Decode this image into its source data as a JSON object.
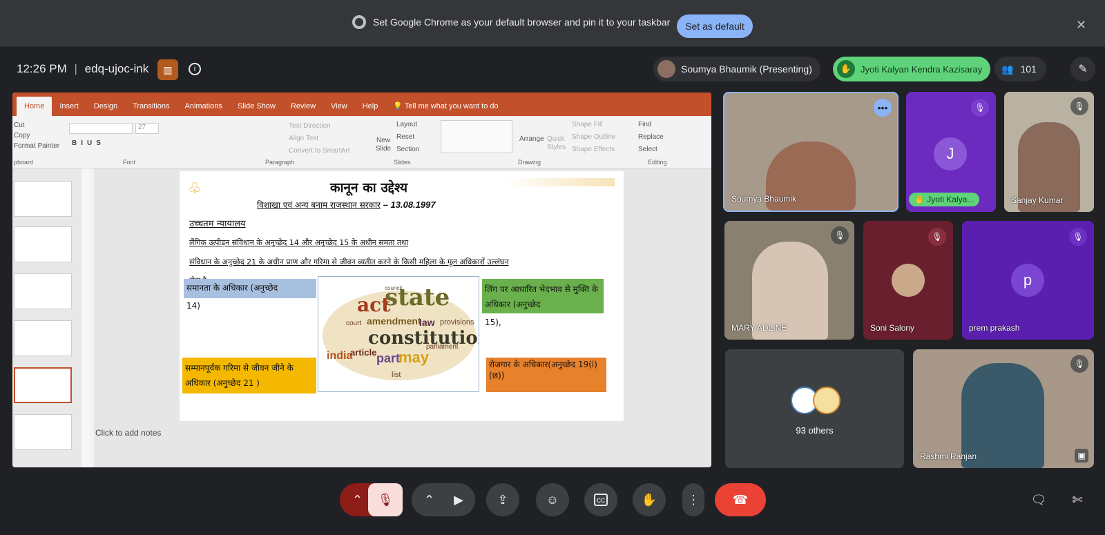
{
  "banner": {
    "message": "Set Google Chrome as your default browser and pin it to your taskbar",
    "button": "Set as default"
  },
  "meeting": {
    "time": "12:26 PM",
    "code": "edq-ujoc-ink",
    "presenter": "Soumya Bhaumik (Presenting)",
    "hand_raised": "Jyoti Kalyan Kendra Kazisaray",
    "participant_count": "101"
  },
  "ppt": {
    "tabs": [
      "Home",
      "Insert",
      "Design",
      "Transitions",
      "Animations",
      "Slide Show",
      "Review",
      "View",
      "Help",
      "Tell me what you want to do"
    ],
    "clipboard": [
      "Cut",
      "Copy",
      "Format Painter"
    ],
    "font_size": "27",
    "paragraph": [
      "Text Direction",
      "Align Text",
      "Convert to SmartArt"
    ],
    "slides": [
      "Layout",
      "Reset",
      "Section"
    ],
    "new_slide": "New Slide",
    "drawing": [
      "Arrange",
      "Quick Styles",
      "Shape Fill",
      "Shape Outline",
      "Shape Effects"
    ],
    "editing": [
      "Find",
      "Replace",
      "Select"
    ],
    "group_labels": [
      "pboard",
      "Font",
      "Paragraph",
      "Slides",
      "Drawing",
      "Editing"
    ],
    "notes": "Click to add notes"
  },
  "slide": {
    "title": "कानून का उद्देश्य",
    "subtitle_left": "विशाखा एवं अन्य बनाम राजस्थान सरकार",
    "subtitle_date": "– 13.08.1997",
    "court": "उच्चतम न्यायालय",
    "line1": "लैंगिक उत्पीड़न संविधान के अनुच्छेद 14 और अनुच्छेद 15 के अधीन समता तथा",
    "line2": "संविधान के अनुच्छेद 21 के अधीन प्राण और गरिमा से जीवन व्यतीत करने के किसी महिला के मूल अधिकारों उल्लंघन",
    "line3": "होता है",
    "box1": "समानता के अधिकार (अनुच्छेद",
    "box1b": "14)",
    "box2": "लिंग पर आधारित भेदभाव से मुक्ति के अधिकार (अनुच्छेद",
    "box2b": "15),",
    "box3": "सम्मानपूर्वक गरिमा से जीवन जीने के अधिकार (अनुच्छेद 21 )",
    "box4": "रोजगार के अधिकार(अनुच्छेद 19(i) (छ))",
    "cloud": [
      "state",
      "act",
      "constitution",
      "amendment",
      "india",
      "article",
      "part",
      "law",
      "may",
      "council",
      "provisions",
      "parliament",
      "court",
      "list"
    ]
  },
  "participants": [
    {
      "name": "Soumya Bhaumik"
    },
    {
      "name": "Jyoti Kalya...",
      "initial": "J"
    },
    {
      "name": "Sanjay Kumar"
    },
    {
      "name": "MARY ADLINE"
    },
    {
      "name": "Soni Salony"
    },
    {
      "name": "prem prakash",
      "initial": "p"
    },
    {
      "name": "93 others"
    },
    {
      "name": "Rashmi Ranjan"
    }
  ]
}
